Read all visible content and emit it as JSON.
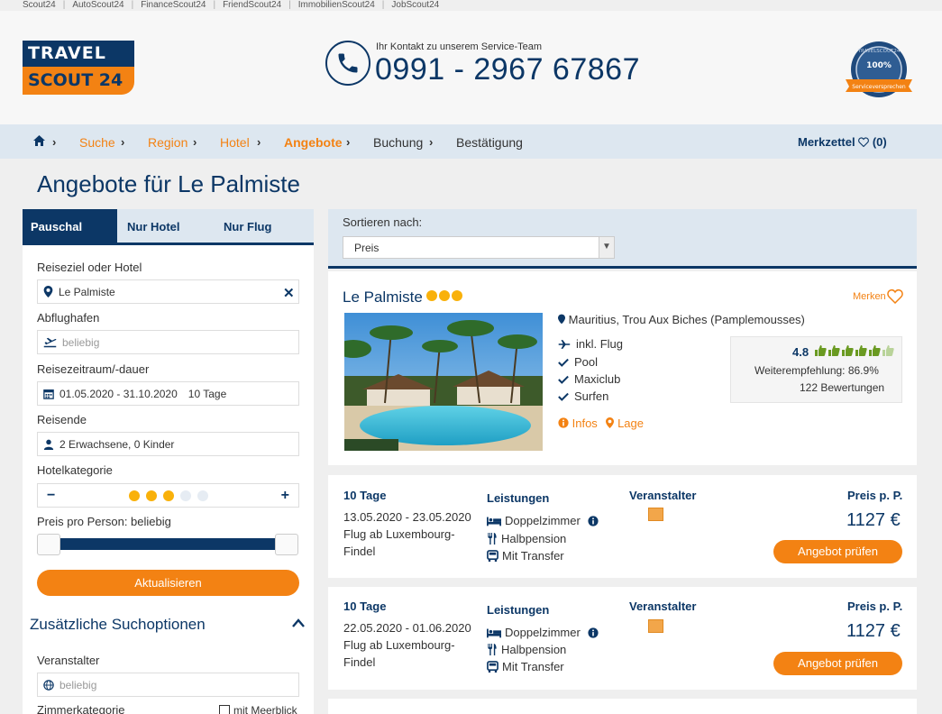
{
  "topnav": [
    "Scout24",
    "AutoScout24",
    "FinanceScout24",
    "FriendScout24",
    "ImmobilienScout24",
    "JobScout24"
  ],
  "logo": {
    "line1": "TRAVEL",
    "line2": "SCOUT 24"
  },
  "contact": {
    "label": "Ihr Kontakt zu unserem Service-Team",
    "number": "0991 - 2967 67867"
  },
  "seal": {
    "top": "TRAVELSCOUT24",
    "percent": "100%",
    "ribbon": "Serviceversprechen"
  },
  "breadcrumb": {
    "items": [
      "Suche",
      "Region",
      "Hotel",
      "Angebote",
      "Buchung",
      "Bestätigung"
    ],
    "merkzettel": "Merkzettel",
    "merk_count": "(0)"
  },
  "page_title": "Angebote für Le Palmiste",
  "tabs": [
    "Pauschal",
    "Nur Hotel",
    "Nur Flug"
  ],
  "search": {
    "dest_label": "Reiseziel oder Hotel",
    "dest_value": "Le Palmiste",
    "airport_label": "Abflughafen",
    "airport_placeholder": "beliebig",
    "period_label": "Reisezeitraum/-dauer",
    "period_value": "01.05.2020 - 31.10.2020",
    "duration": "10 Tage",
    "travelers_label": "Reisende",
    "travelers_value": "2 Erwachsene, 0 Kinder",
    "category_label": "Hotelkategorie",
    "category_value": 3,
    "category_max": 5,
    "price_label": "Preis pro Person: beliebig",
    "update_button": "Aktualisieren",
    "extra_title": "Zusätzliche Suchoptionen",
    "operator_label": "Veranstalter",
    "operator_placeholder": "beliebig",
    "room_label": "Zimmerkategorie",
    "seaview_label": "mit Meerblick"
  },
  "sort": {
    "label": "Sortieren nach:",
    "value": "Preis"
  },
  "hotel": {
    "name": "Le Palmiste",
    "stars": 3,
    "merken": "Merken",
    "location": "Mauritius, Trou Aux Biches (Pamplemousses)",
    "features": [
      "inkl. Flug",
      "Pool",
      "Maxiclub",
      "Surfen"
    ],
    "infos": "Infos",
    "lage": "Lage",
    "rating": "4.8",
    "recommend": "Weiterempfehlung: 86.9%",
    "reviews": "122 Bewertungen"
  },
  "offer_headers": {
    "services": "Leistungen",
    "operator": "Veranstalter",
    "price": "Preis p. P."
  },
  "offers": [
    {
      "days": "10 Tage",
      "dates": "13.05.2020 - 23.05.2020",
      "flight1": "Flug ab Luxembourg-",
      "flight2": "Findel",
      "room": "Doppelzimmer",
      "board": "Halbpension",
      "transfer": "Mit Transfer",
      "price": "1127 €",
      "button": "Angebot prüfen"
    },
    {
      "days": "10 Tage",
      "dates": "22.05.2020 - 01.06.2020",
      "flight1": "Flug ab Luxembourg-",
      "flight2": "Findel",
      "room": "Doppelzimmer",
      "board": "Halbpension",
      "transfer": "Mit Transfer",
      "price": "1127 €",
      "button": "Angebot prüfen"
    }
  ],
  "colors": {
    "navy": "#0c3766",
    "orange": "#f38213",
    "star": "#f9b10a",
    "rating_green": "#6a9a21"
  }
}
